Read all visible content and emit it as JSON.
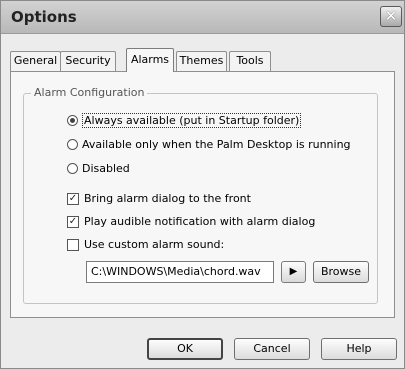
{
  "window": {
    "title": "Options",
    "close_glyph": "✕"
  },
  "tabs": [
    {
      "label": "General",
      "active": false
    },
    {
      "label": "Security",
      "active": false
    },
    {
      "label": "Alarms",
      "active": true
    },
    {
      "label": "Themes",
      "active": false
    },
    {
      "label": "Tools",
      "active": false
    }
  ],
  "group": {
    "legend": "Alarm Configuration",
    "radios": [
      {
        "label": "Always available (put in Startup folder)",
        "checked": true
      },
      {
        "label": "Available only when the Palm Desktop is running",
        "checked": false
      },
      {
        "label": "Disabled",
        "checked": false
      }
    ],
    "checkboxes": [
      {
        "label": "Bring alarm dialog to the front",
        "checked": true
      },
      {
        "label": "Play audible notification with alarm dialog",
        "checked": true
      },
      {
        "label": "Use custom alarm sound:",
        "checked": false
      }
    ],
    "sound_path": "C:\\WINDOWS\\Media\\chord.wav",
    "play_glyph": "▶",
    "browse_label": "Browse"
  },
  "buttons": {
    "ok": "OK",
    "cancel": "Cancel",
    "help": "Help"
  },
  "colors": {
    "titlebar": "#c4c4c4",
    "dialog_bg": "#ececec",
    "panel_bg": "#f7f7f7"
  }
}
